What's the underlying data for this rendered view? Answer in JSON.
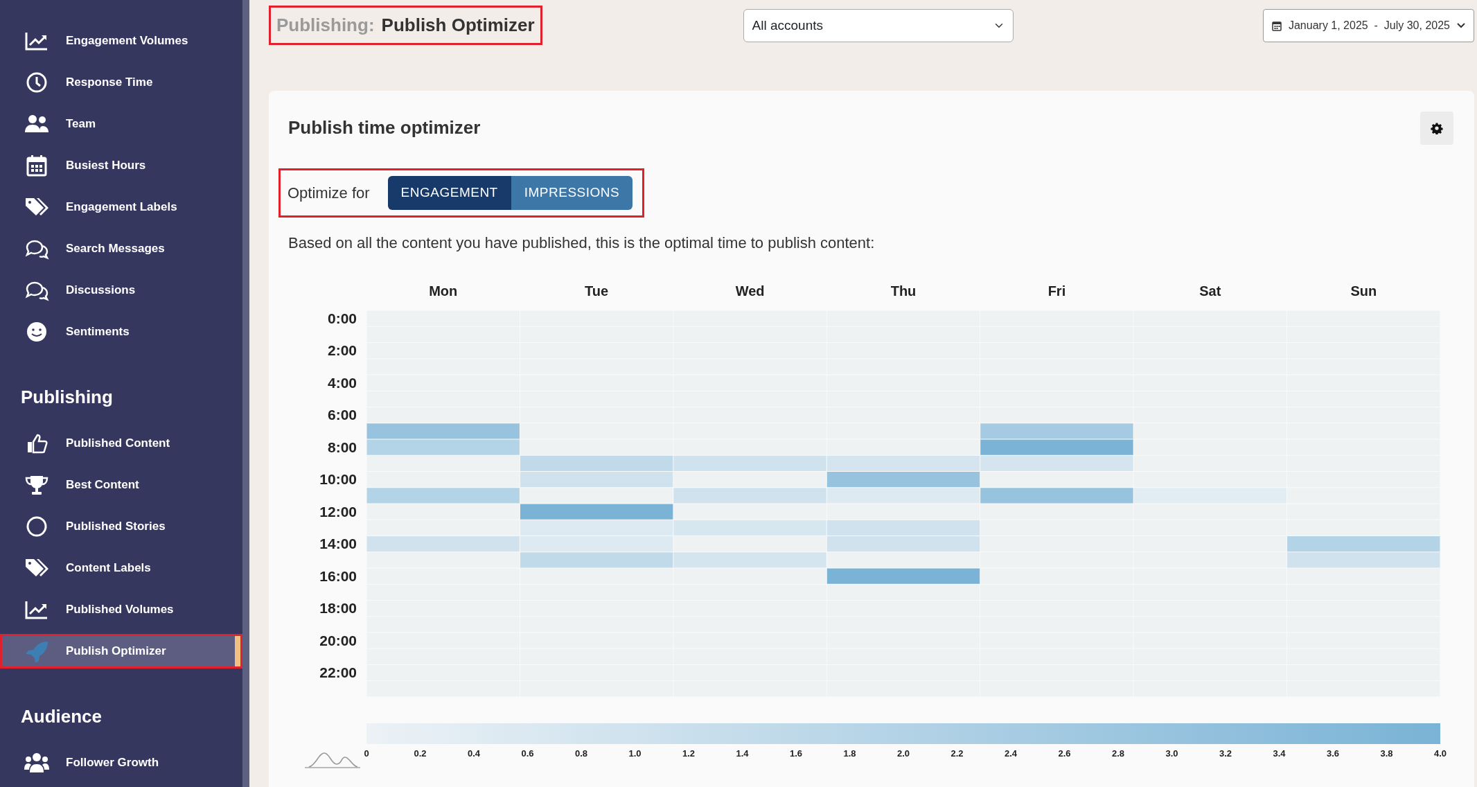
{
  "sidebar": {
    "sections": [
      {
        "items": [
          {
            "label": "Engagement Volumes",
            "selected": false,
            "highlighted": false
          },
          {
            "label": "Response Time",
            "selected": false,
            "highlighted": false
          },
          {
            "label": "Team",
            "selected": false,
            "highlighted": false
          },
          {
            "label": "Busiest Hours",
            "selected": false,
            "highlighted": false
          },
          {
            "label": "Engagement Labels",
            "selected": false,
            "highlighted": false
          },
          {
            "label": "Search Messages",
            "selected": false,
            "highlighted": false
          },
          {
            "label": "Discussions",
            "selected": false,
            "highlighted": false
          },
          {
            "label": "Sentiments",
            "selected": false,
            "highlighted": false
          }
        ]
      },
      {
        "title": "Publishing",
        "items": [
          {
            "label": "Published Content",
            "selected": false,
            "highlighted": false
          },
          {
            "label": "Best Content",
            "selected": false,
            "highlighted": false
          },
          {
            "label": "Published Stories",
            "selected": false,
            "highlighted": false
          },
          {
            "label": "Content Labels",
            "selected": false,
            "highlighted": false
          },
          {
            "label": "Published Volumes",
            "selected": false,
            "highlighted": false
          },
          {
            "label": "Publish Optimizer",
            "selected": true,
            "highlighted": true
          }
        ]
      },
      {
        "title": "Audience",
        "items": [
          {
            "label": "Follower Growth",
            "selected": false,
            "highlighted": false
          }
        ]
      }
    ]
  },
  "header": {
    "section": "Publishing:",
    "title": "Publish Optimizer",
    "highlighted": true,
    "account_select": {
      "value": "All accounts"
    },
    "date_range": {
      "value": "January 1, 2025  -  July 30, 2025"
    }
  },
  "card": {
    "title": "Publish time optimizer",
    "optimize_label": "Optimize for",
    "optimize_highlighted": true,
    "options": [
      {
        "label": "ENGAGEMENT",
        "selected": true
      },
      {
        "label": "IMPRESSIONS",
        "selected": false
      }
    ],
    "description": "Based on all the content you have published, this is the optimal time to publish content:",
    "heatmap": {
      "days": [
        "Mon",
        "Tue",
        "Wed",
        "Thu",
        "Fri",
        "Sat",
        "Sun"
      ],
      "hour_labels": [
        "0:00",
        "2:00",
        "4:00",
        "6:00",
        "8:00",
        "10:00",
        "12:00",
        "14:00",
        "16:00",
        "18:00",
        "20:00",
        "22:00"
      ],
      "rows": [
        {
          "cells": [
            {
              "color": "#eff2f2"
            },
            {
              "color": "#eff2f2"
            },
            {
              "color": "#eff2f2"
            },
            {
              "color": "#eff2f2"
            },
            {
              "color": "#eff2f2"
            },
            {
              "color": "#eff2f2"
            },
            {
              "color": "#eff2f2"
            }
          ]
        },
        {
          "cells": [
            {
              "color": "#eff2f2"
            },
            {
              "color": "#eff2f2"
            },
            {
              "color": "#eff2f2"
            },
            {
              "color": "#eff2f2"
            },
            {
              "color": "#eff2f2"
            },
            {
              "color": "#eff2f2"
            },
            {
              "color": "#eff2f2"
            }
          ]
        },
        {
          "cells": [
            {
              "color": "#eff2f2"
            },
            {
              "color": "#eff2f2"
            },
            {
              "color": "#eff2f2"
            },
            {
              "color": "#eff2f2"
            },
            {
              "color": "#eff2f2"
            },
            {
              "color": "#eff2f2"
            },
            {
              "color": "#eff2f2"
            }
          ]
        },
        {
          "cells": [
            {
              "color": "#eff2f2"
            },
            {
              "color": "#eff2f2"
            },
            {
              "color": "#eff2f2"
            },
            {
              "color": "#eff2f2"
            },
            {
              "color": "#eff2f2"
            },
            {
              "color": "#eff2f2"
            },
            {
              "color": "#eff2f2"
            }
          ]
        },
        {
          "cells": [
            {
              "color": "#eff2f2"
            },
            {
              "color": "#eff2f2"
            },
            {
              "color": "#eff2f2"
            },
            {
              "color": "#eff2f2"
            },
            {
              "color": "#eff2f2"
            },
            {
              "color": "#eff2f2"
            },
            {
              "color": "#eff2f2"
            }
          ]
        },
        {
          "cells": [
            {
              "color": "#eff2f2"
            },
            {
              "color": "#eff2f2"
            },
            {
              "color": "#eff2f2"
            },
            {
              "color": "#eff2f2"
            },
            {
              "color": "#eff2f2"
            },
            {
              "color": "#eff2f2"
            },
            {
              "color": "#eff2f2"
            }
          ]
        },
        {
          "cells": [
            {
              "color": "#eff2f2"
            },
            {
              "color": "#eff2f2"
            },
            {
              "color": "#eff2f2"
            },
            {
              "color": "#eff2f2"
            },
            {
              "color": "#eff2f2"
            },
            {
              "color": "#eff2f2"
            },
            {
              "color": "#eff2f2"
            }
          ]
        },
        {
          "cells": [
            {
              "color": "#97c3de"
            },
            {
              "color": "#eff2f2"
            },
            {
              "color": "#eff2f2"
            },
            {
              "color": "#eff2f2"
            },
            {
              "color": "#a5cbe2"
            },
            {
              "color": "#eff2f2"
            },
            {
              "color": "#eff2f2"
            }
          ]
        },
        {
          "cells": [
            {
              "color": "#b3d3e6"
            },
            {
              "color": "#eff2f2"
            },
            {
              "color": "#eff2f2"
            },
            {
              "color": "#eff2f2"
            },
            {
              "color": "#7ab3d6"
            },
            {
              "color": "#eff2f2"
            },
            {
              "color": "#eff2f2"
            }
          ]
        },
        {
          "cells": [
            {
              "color": "#eff2f2"
            },
            {
              "color": "#c1daea"
            },
            {
              "color": "#d0e2ee"
            },
            {
              "color": "#d5e5f0"
            },
            {
              "color": "#d5e5f0"
            },
            {
              "color": "#eff2f2"
            },
            {
              "color": "#eff2f2"
            }
          ]
        },
        {
          "cells": [
            {
              "color": "#eff2f2"
            },
            {
              "color": "#d0e2ee"
            },
            {
              "color": "#eff2f2"
            },
            {
              "color": "#97c3de"
            },
            {
              "color": "#eff2f2"
            },
            {
              "color": "#eff2f2"
            },
            {
              "color": "#eff2f2"
            }
          ]
        },
        {
          "cells": [
            {
              "color": "#b3d3e6"
            },
            {
              "color": "#eff2f2"
            },
            {
              "color": "#d0e2ee"
            },
            {
              "color": "#deeaf2"
            },
            {
              "color": "#97c3de"
            },
            {
              "color": "#e1ecf3"
            },
            {
              "color": "#eff2f2"
            }
          ]
        },
        {
          "cells": [
            {
              "color": "#eff2f2"
            },
            {
              "color": "#7ab3d6"
            },
            {
              "color": "#eff2f2"
            },
            {
              "color": "#eff2f2"
            },
            {
              "color": "#eff2f2"
            },
            {
              "color": "#eff2f2"
            },
            {
              "color": "#eff2f2"
            }
          ]
        },
        {
          "cells": [
            {
              "color": "#eff2f2"
            },
            {
              "color": "#deeaf2"
            },
            {
              "color": "#d7e7f0"
            },
            {
              "color": "#d0e2ee"
            },
            {
              "color": "#eff2f2"
            },
            {
              "color": "#eff2f2"
            },
            {
              "color": "#eff2f2"
            }
          ]
        },
        {
          "cells": [
            {
              "color": "#d0e2ee"
            },
            {
              "color": "#deeaf2"
            },
            {
              "color": "#eff2f2"
            },
            {
              "color": "#d0e2ee"
            },
            {
              "color": "#eff2f2"
            },
            {
              "color": "#eff2f2"
            },
            {
              "color": "#b3d3e6"
            }
          ]
        },
        {
          "cells": [
            {
              "color": "#eff2f2"
            },
            {
              "color": "#c1daea"
            },
            {
              "color": "#d5e5f0"
            },
            {
              "color": "#eff2f2"
            },
            {
              "color": "#eff2f2"
            },
            {
              "color": "#eff2f2"
            },
            {
              "color": "#d0e2ee"
            }
          ]
        },
        {
          "cells": [
            {
              "color": "#eff2f2"
            },
            {
              "color": "#eff2f2"
            },
            {
              "color": "#eff2f2"
            },
            {
              "color": "#7ab3d6"
            },
            {
              "color": "#eff2f2"
            },
            {
              "color": "#eff2f2"
            },
            {
              "color": "#eff2f2"
            }
          ]
        },
        {
          "cells": [
            {
              "color": "#eff2f2"
            },
            {
              "color": "#eff2f2"
            },
            {
              "color": "#eff2f2"
            },
            {
              "color": "#eff2f2"
            },
            {
              "color": "#eff2f2"
            },
            {
              "color": "#eff2f2"
            },
            {
              "color": "#eff2f2"
            }
          ]
        },
        {
          "cells": [
            {
              "color": "#eff2f2"
            },
            {
              "color": "#eff2f2"
            },
            {
              "color": "#eff2f2"
            },
            {
              "color": "#eff2f2"
            },
            {
              "color": "#eff2f2"
            },
            {
              "color": "#eff2f2"
            },
            {
              "color": "#eff2f2"
            }
          ]
        },
        {
          "cells": [
            {
              "color": "#eff2f2"
            },
            {
              "color": "#eff2f2"
            },
            {
              "color": "#eff2f2"
            },
            {
              "color": "#eff2f2"
            },
            {
              "color": "#eff2f2"
            },
            {
              "color": "#eff2f2"
            },
            {
              "color": "#eff2f2"
            }
          ]
        },
        {
          "cells": [
            {
              "color": "#eff2f2"
            },
            {
              "color": "#eff2f2"
            },
            {
              "color": "#eff2f2"
            },
            {
              "color": "#eff2f2"
            },
            {
              "color": "#eff2f2"
            },
            {
              "color": "#eff2f2"
            },
            {
              "color": "#eff2f2"
            }
          ]
        },
        {
          "cells": [
            {
              "color": "#eff2f2"
            },
            {
              "color": "#eff2f2"
            },
            {
              "color": "#eff2f2"
            },
            {
              "color": "#eff2f2"
            },
            {
              "color": "#eff2f2"
            },
            {
              "color": "#eff2f2"
            },
            {
              "color": "#eff2f2"
            }
          ]
        },
        {
          "cells": [
            {
              "color": "#eff2f2"
            },
            {
              "color": "#eff2f2"
            },
            {
              "color": "#eff2f2"
            },
            {
              "color": "#eff2f2"
            },
            {
              "color": "#eff2f2"
            },
            {
              "color": "#eff2f2"
            },
            {
              "color": "#eff2f2"
            }
          ]
        },
        {
          "cells": [
            {
              "color": "#eff2f2"
            },
            {
              "color": "#eff2f2"
            },
            {
              "color": "#eff2f2"
            },
            {
              "color": "#eff2f2"
            },
            {
              "color": "#eff2f2"
            },
            {
              "color": "#eff2f2"
            },
            {
              "color": "#eff2f2"
            }
          ]
        }
      ],
      "scale_labels": [
        "0",
        "0.2",
        "0.4",
        "0.6",
        "0.8",
        "1.0",
        "1.2",
        "1.4",
        "1.6",
        "1.8",
        "2.0",
        "2.2",
        "2.4",
        "2.6",
        "2.8",
        "3.0",
        "3.2",
        "3.4",
        "3.6",
        "3.8",
        "4.0"
      ]
    }
  }
}
